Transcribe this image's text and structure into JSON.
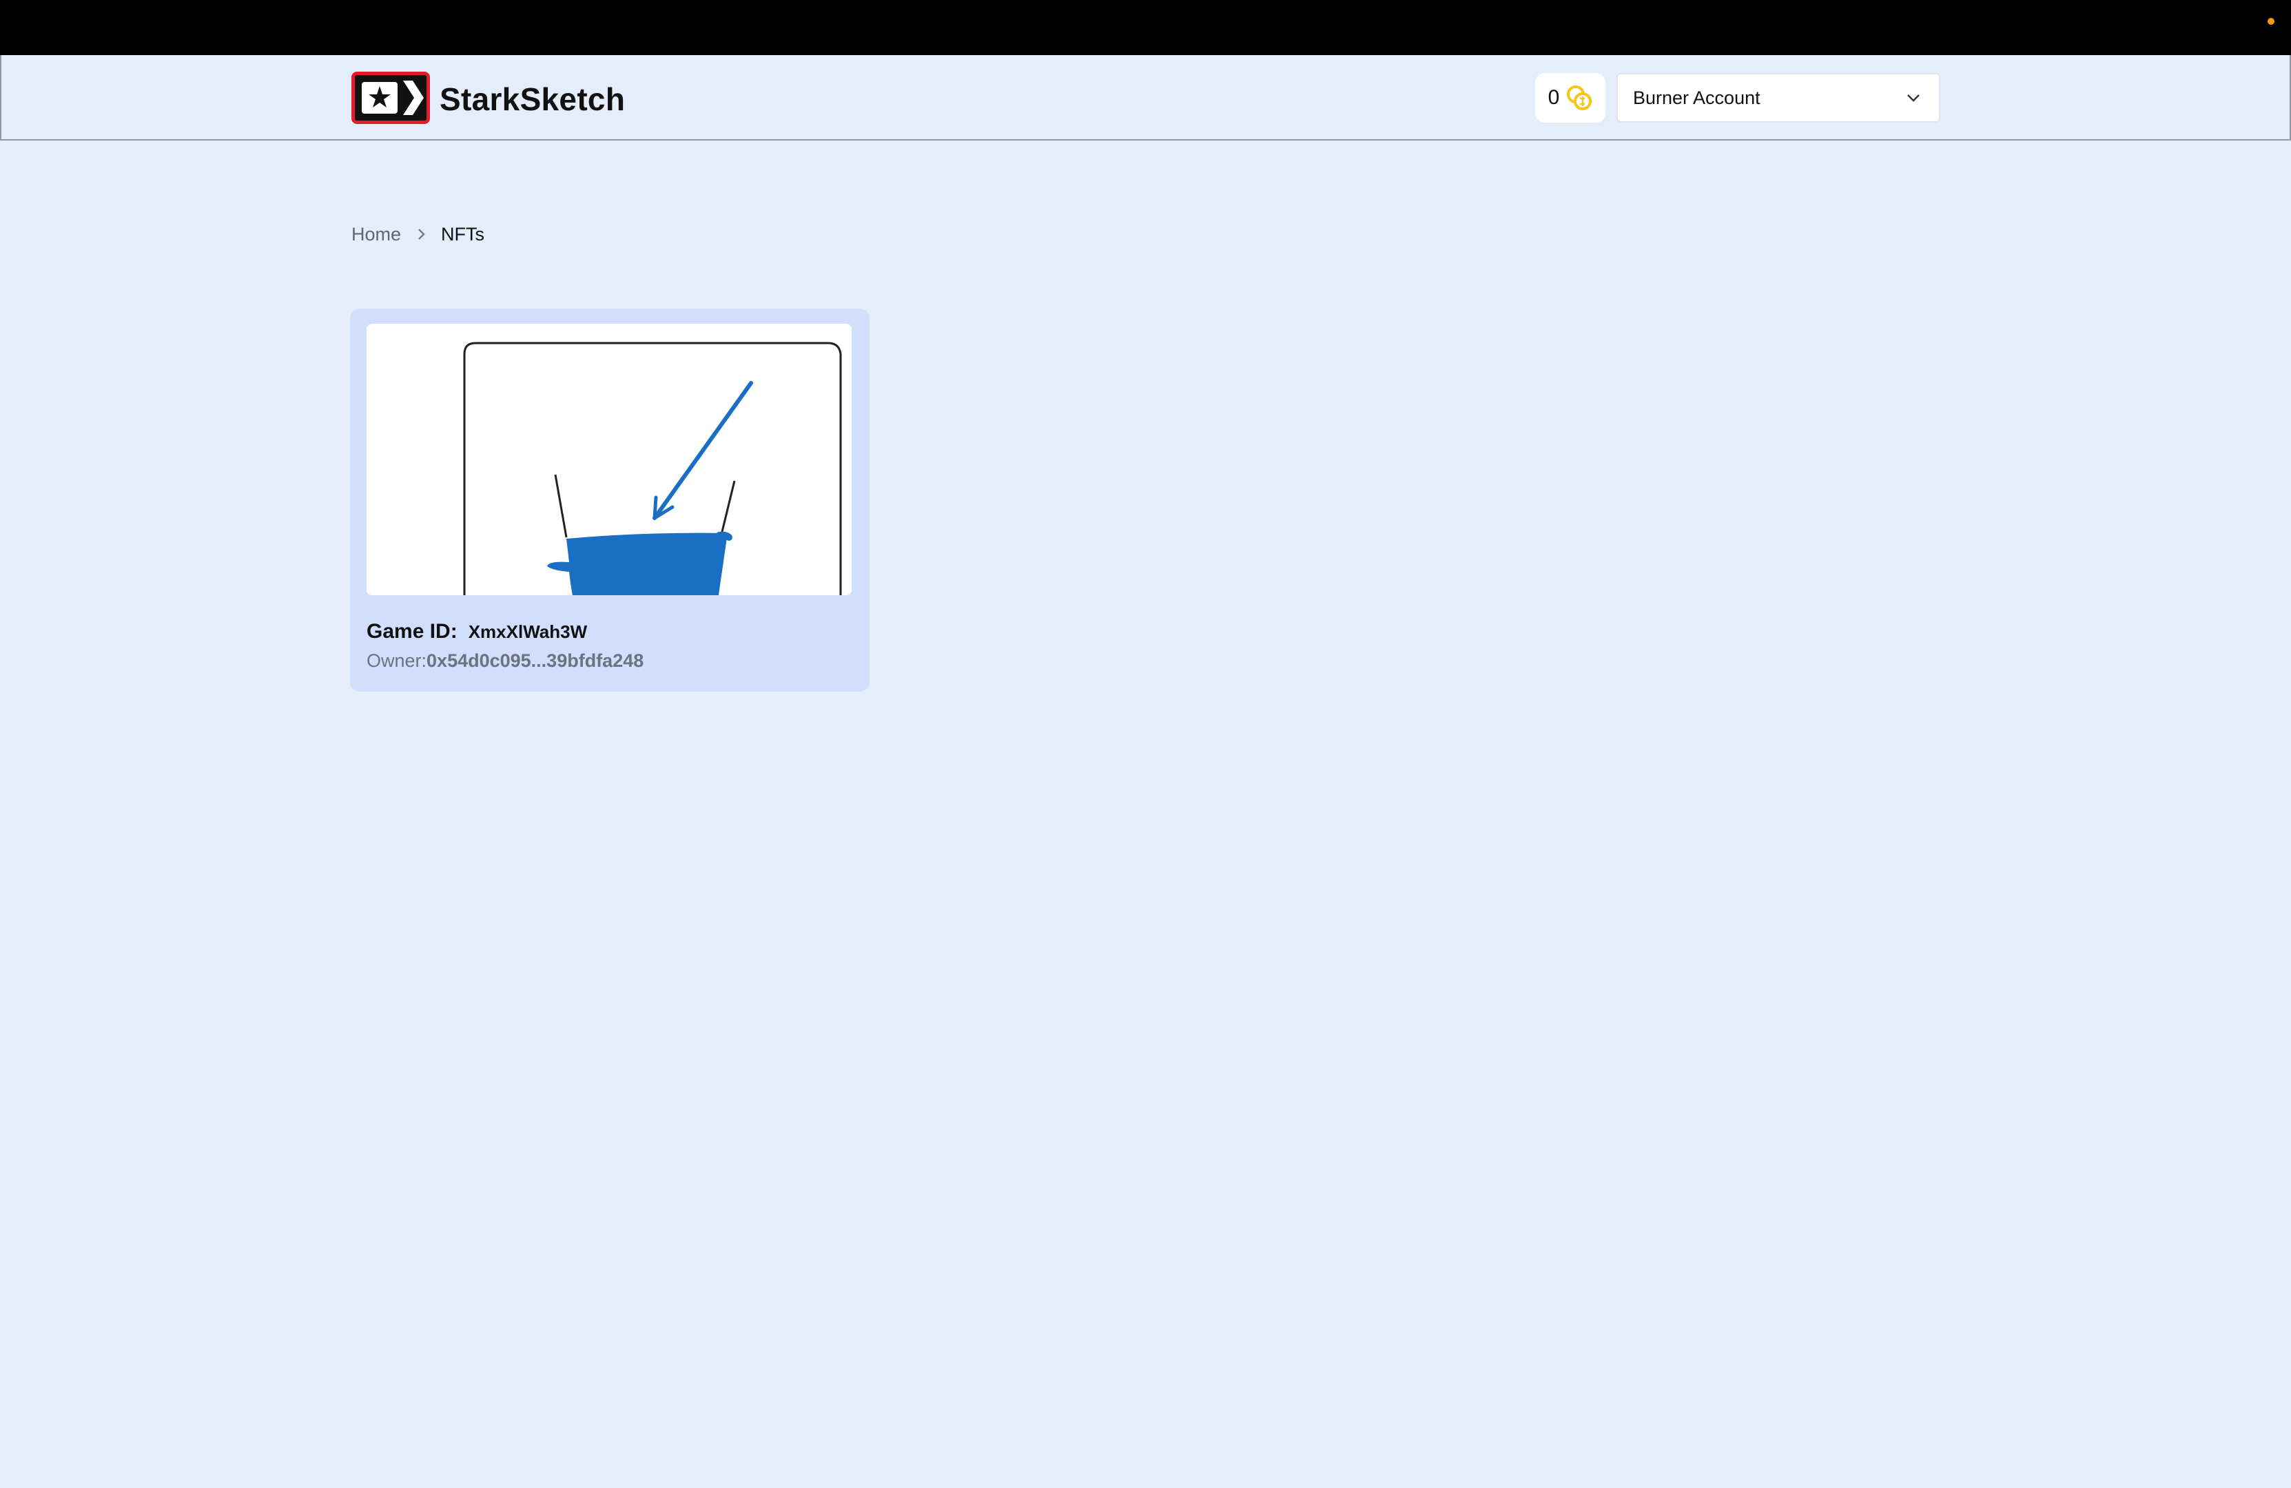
{
  "app": {
    "brand": "StarkSketch",
    "logo_icon": "starknet-star-chevron-logo"
  },
  "header": {
    "balance": "0",
    "coin_icon": "coins-icon",
    "account_select": {
      "selected": "Burner Account",
      "icon": "chevron-down-icon"
    }
  },
  "breadcrumb": {
    "home": "Home",
    "separator_icon": "chevron-right-icon",
    "current": "NFTs"
  },
  "nfts": [
    {
      "game_id_label": "Game ID:",
      "game_id": "XmxXlWah3W",
      "owner_label": "Owner:",
      "owner": "0x54d0c095...39bfdfa248",
      "image": "sketch-drawing"
    }
  ],
  "colors": {
    "background": "#e5edfb",
    "card": "#d2dffc",
    "logo_border": "#e11d2a",
    "coin": "#f5c518",
    "sketch_blue": "#1a6fc4"
  }
}
